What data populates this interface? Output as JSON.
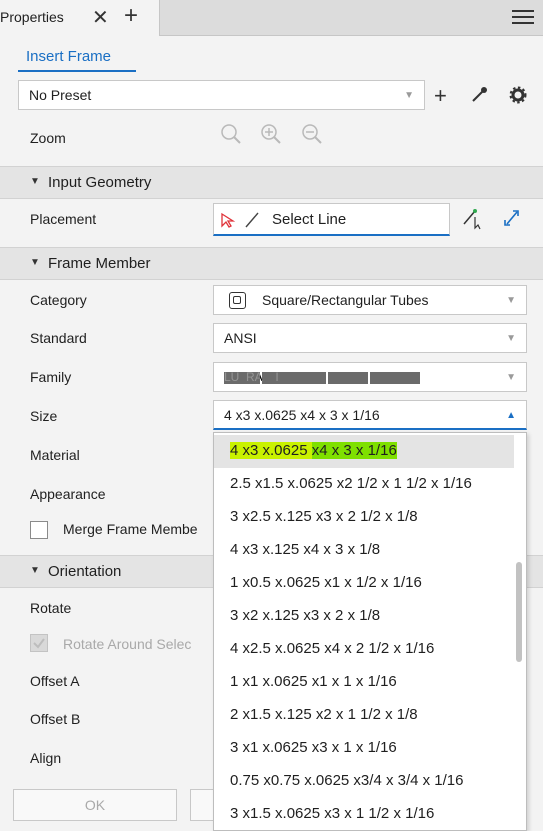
{
  "tabs": {
    "label": "Properties",
    "close": "✕",
    "add": "+"
  },
  "header": {
    "title": "Insert Frame"
  },
  "preset": {
    "value": "No Preset"
  },
  "zoom": {
    "label": "Zoom"
  },
  "sections": {
    "input_geometry": "Input Geometry",
    "frame_member": "Frame Member",
    "orientation": "Orientation"
  },
  "placement": {
    "label": "Placement",
    "value": "Select Line"
  },
  "frame_member": {
    "category": {
      "label": "Category",
      "value": "Square/Rectangular Tubes"
    },
    "standard": {
      "label": "Standard",
      "value": "ANSI"
    },
    "family": {
      "label": "Family",
      "value_visible": "LU  RA    I"
    },
    "size": {
      "label": "Size",
      "value": "4 x3 x.0625 x4 x 3 x 1/16"
    },
    "material": {
      "label": "Material"
    },
    "appearance": {
      "label": "Appearance"
    },
    "merge": {
      "label": "Merge Frame Membe"
    }
  },
  "orientation": {
    "rotate": {
      "label": "Rotate"
    },
    "rotate_around": {
      "label": "Rotate Around Selec"
    },
    "offset_a": {
      "label": "Offset A"
    },
    "offset_b": {
      "label": "Offset B"
    },
    "align": {
      "label": "Align"
    }
  },
  "buttons": {
    "ok": "OK"
  },
  "size_dropdown": {
    "selected_part1": "4 x3 x.0625 ",
    "selected_part2": "x4 x 3 x 1/16",
    "items": [
      "2.5 x1.5 x.0625 x2 1/2 x 1 1/2 x 1/16",
      "3 x2.5 x.125 x3 x 2 1/2 x 1/8",
      "4 x3 x.125 x4 x 3 x 1/8",
      "1 x0.5 x.0625 x1 x 1/2 x 1/16",
      "3 x2 x.125 x3 x 2 x 1/8",
      "4 x2.5 x.0625 x4 x 2 1/2 x 1/16",
      "1 x1 x.0625 x1 x 1 x 1/16",
      "2 x1.5 x.125 x2 x 1 1/2 x 1/8",
      "3 x1 x.0625 x3 x 1 x 1/16",
      "0.75 x0.75 x.0625 x3/4 x 3/4 x 1/16",
      "3 x1.5 x.0625 x3 x 1 1/2 x 1/16"
    ]
  },
  "colors": {
    "accent": "#1a6fc4",
    "highlight": "#7fe000"
  }
}
